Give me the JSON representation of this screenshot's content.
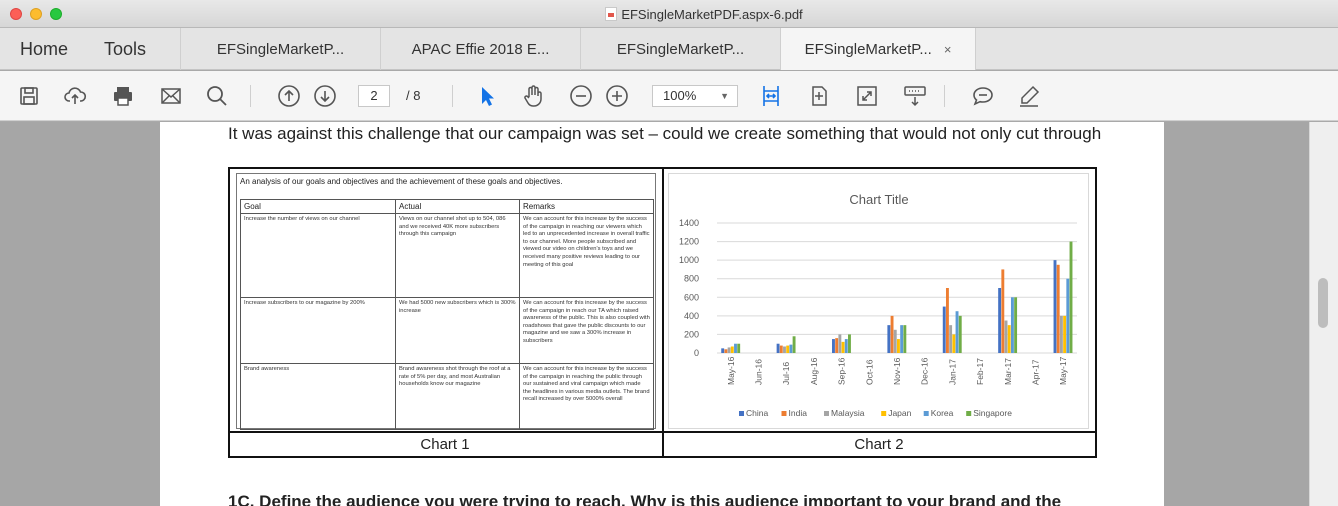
{
  "window": {
    "title": "EFSingleMarketPDF.aspx-6.pdf"
  },
  "nav": {
    "home": "Home",
    "tools": "Tools"
  },
  "tabs": [
    {
      "label": "EFSingleMarketP..."
    },
    {
      "label": "APAC Effie 2018 E..."
    },
    {
      "label": "EFSingleMarketP..."
    },
    {
      "label": "EFSingleMarketP...",
      "close": "×"
    }
  ],
  "toolbar": {
    "page_current": "2",
    "page_total": "/ 8",
    "zoom": "100%",
    "icons": [
      "save-icon",
      "upload-icon",
      "print-icon",
      "email-icon",
      "search-icon",
      "page-up-icon",
      "page-down-icon",
      "select-arrow-icon",
      "hand-icon",
      "zoom-out-icon",
      "zoom-in-icon",
      "fit-width-icon",
      "fit-page-icon",
      "fullscreen-icon",
      "scroll-mode-icon",
      "comment-icon",
      "sign-icon"
    ]
  },
  "document": {
    "intro_text": "It was against this challenge that our campaign was set – could we create something that would not only cut through",
    "heading_1c": "1C. Define the audience you were trying to reach. Why is this audience important to your brand and the",
    "chart1": {
      "caption": "Chart 1",
      "title": "An analysis of our goals and objectives and the achievement of these goals and objectives.",
      "headers": [
        "Goal",
        "Actual",
        "Remarks"
      ],
      "rows": [
        {
          "goal": "Increase the number of views on our channel",
          "actual": "Views on our channel shot up to 504, 086 and we received 40K more subscribers through this campaign",
          "remarks": "We can account for this increase by the success of the campaign in reaching our viewers which led to an unprecedented increase in overall traffic to our channel. More people subscribed and viewed our video on children's toys and we received many positive reviews leading to our meeting of this goal"
        },
        {
          "goal": "Increase subscribers to our magazine by 200%",
          "actual": "We had 5000 new subscribers which is 300% increase",
          "remarks": "We can account for this increase by the success of the campaign in reach our TA which raised awareness of the public. This is also coupled with roadshows that gave the public discounts to our magazine and we saw a 300% increase in subscribers"
        },
        {
          "goal": "Brand awareness",
          "actual": "Brand awareness shot through the roof at a rate of 5% per day, and most Australian households know our magazine",
          "remarks": "We can account for this increase by the success of the campaign in reaching the public through our sustained and viral campaign which made the headlines in various media outlets. The brand recall increased by over 5000% overall"
        }
      ]
    },
    "chart2": {
      "caption": "Chart 2"
    }
  },
  "chart_data": {
    "type": "bar",
    "title": "Chart Title",
    "categories": [
      "May-16",
      "Jun-16",
      "Jul-16",
      "Aug-16",
      "Sep-16",
      "Oct-16",
      "Nov-16",
      "Dec-16",
      "Jan-17",
      "Feb-17",
      "Mar-17",
      "Apr-17",
      "May-17"
    ],
    "ylim": [
      0,
      1400
    ],
    "yticks": [
      "0",
      "200",
      "400",
      "600",
      "800",
      "1000",
      "1200",
      "1400"
    ],
    "grid": true,
    "legend": "bottom",
    "series": [
      {
        "name": "China",
        "color": "#4472c4",
        "values": [
          50,
          0,
          100,
          0,
          150,
          0,
          300,
          0,
          500,
          0,
          700,
          0,
          1000
        ]
      },
      {
        "name": "India",
        "color": "#ed7d31",
        "values": [
          40,
          0,
          80,
          0,
          160,
          0,
          400,
          0,
          700,
          0,
          900,
          0,
          950
        ]
      },
      {
        "name": "Malaysia",
        "color": "#a5a5a5",
        "values": [
          60,
          0,
          70,
          0,
          200,
          0,
          250,
          0,
          300,
          0,
          350,
          0,
          400
        ]
      },
      {
        "name": "Japan",
        "color": "#ffc000",
        "values": [
          70,
          0,
          80,
          0,
          120,
          0,
          150,
          0,
          200,
          0,
          300,
          0,
          400
        ]
      },
      {
        "name": "Korea",
        "color": "#5b9bd5",
        "values": [
          100,
          0,
          90,
          0,
          150,
          0,
          300,
          0,
          450,
          0,
          600,
          0,
          800
        ]
      },
      {
        "name": "Singapore",
        "color": "#70ad47",
        "values": [
          100,
          0,
          180,
          0,
          200,
          0,
          300,
          0,
          400,
          0,
          600,
          0,
          1200
        ]
      }
    ]
  }
}
